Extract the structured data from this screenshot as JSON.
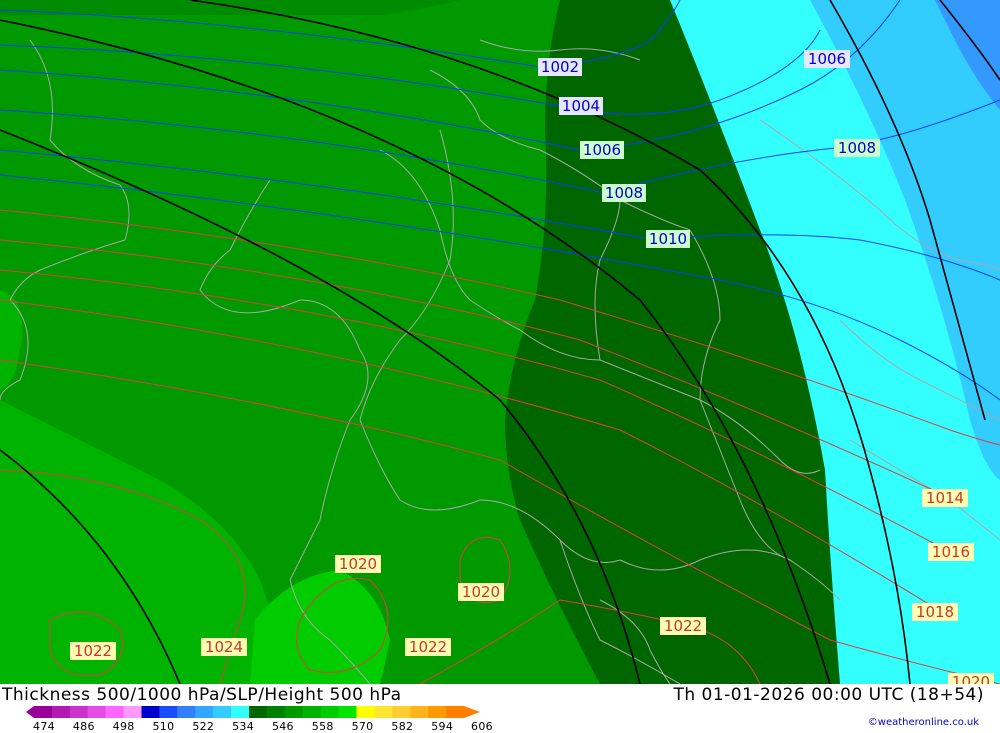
{
  "map": {
    "colors": {
      "ocean": "#33ccff",
      "band_cyan": "#33ffff",
      "band_blue": "#33ccff",
      "band_deepblue": "#3399ff",
      "green_dark": "#006600",
      "green_mid": "#008c00",
      "green_main": "#009900",
      "green_light": "#00b300",
      "green_bright": "#00cc00",
      "blue_isobar": "#0040ff",
      "red_isobar": "#d94040",
      "height_line": "#000000",
      "border": "#a0a0a0"
    },
    "pressure_labels": [
      {
        "text": "1002",
        "style": "blue"
      },
      {
        "text": "1004",
        "style": "blue"
      },
      {
        "text": "1006",
        "style": "blue"
      },
      {
        "text": "1006",
        "style": "blue"
      },
      {
        "text": "1008",
        "style": "blue"
      },
      {
        "text": "1008",
        "style": "blue"
      },
      {
        "text": "1010",
        "style": "blue"
      },
      {
        "text": "1014",
        "style": "red"
      },
      {
        "text": "1016",
        "style": "red"
      },
      {
        "text": "1018",
        "style": "red"
      },
      {
        "text": "1020",
        "style": "red"
      },
      {
        "text": "1020",
        "style": "red"
      },
      {
        "text": "1020",
        "style": "red"
      },
      {
        "text": "1022",
        "style": "red"
      },
      {
        "text": "1022",
        "style": "red"
      },
      {
        "text": "1022",
        "style": "red"
      },
      {
        "text": "1024",
        "style": "red"
      }
    ]
  },
  "footer": {
    "title": "Thickness 500/1000 hPa/SLP/Height 500 hPa",
    "datetime": "Th 01-01-2026 00:00 UTC (18+54)",
    "credit": "©weatheronline.co.uk",
    "scale_ticks": [
      "474",
      "486",
      "498",
      "510",
      "522",
      "534",
      "546",
      "558",
      "570",
      "582",
      "594",
      "606"
    ],
    "scale_colors": [
      "#990099",
      "#b31ab3",
      "#cc33cc",
      "#e64de6",
      "#ff66ff",
      "#ff99ff",
      "#0000cc",
      "#1a4dff",
      "#3380ff",
      "#33a6ff",
      "#33ccff",
      "#33ffff",
      "#006600",
      "#008000",
      "#009900",
      "#00b300",
      "#00cc00",
      "#00e600",
      "#ffff00",
      "#ffe633",
      "#ffcc33",
      "#ffb31a",
      "#ff9900",
      "#ff8000"
    ]
  }
}
